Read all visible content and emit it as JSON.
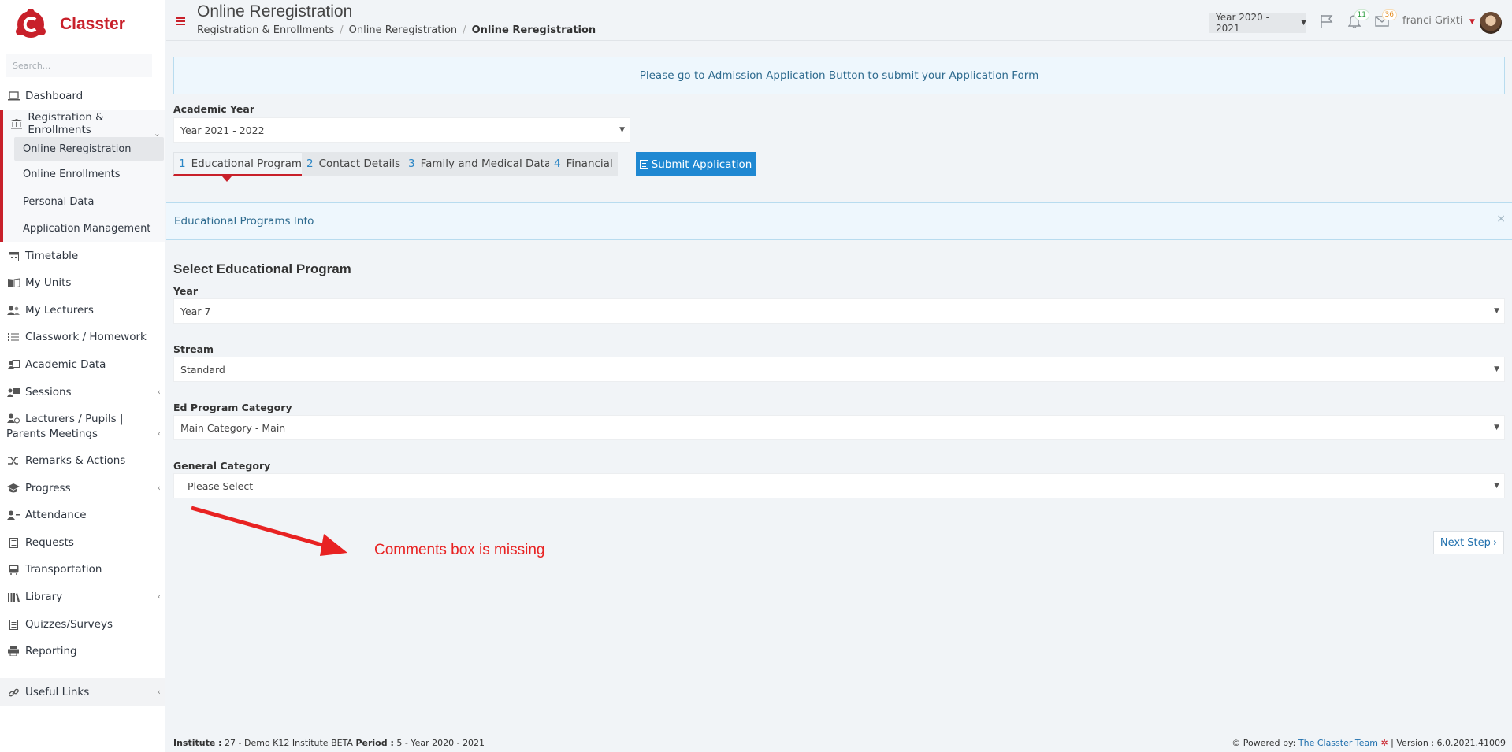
{
  "brand": {
    "name": "Classter",
    "accent": "#c8202a"
  },
  "search": {
    "placeholder": "Search..."
  },
  "sidebar": {
    "items": [
      {
        "label": "Dashboard",
        "icon": "laptop-icon"
      },
      {
        "label": "Registration & Enrollments",
        "icon": "bank-icon"
      },
      {
        "label": "Timetable",
        "icon": "calendar-icon"
      },
      {
        "label": "My Units",
        "icon": "book-icon"
      },
      {
        "label": "My Lecturers",
        "icon": "users-icon"
      },
      {
        "label": "Classwork / Homework",
        "icon": "tasks-icon"
      },
      {
        "label": "Academic Data",
        "icon": "id-card-icon"
      },
      {
        "label": "Sessions",
        "icon": "presentation-icon"
      },
      {
        "label": "Lecturers / Pupils | Parents Meetings",
        "icon": "meeting-icon"
      },
      {
        "label": "Remarks & Actions",
        "icon": "shuffle-icon"
      },
      {
        "label": "Progress",
        "icon": "graduation-cap-icon"
      },
      {
        "label": "Attendance",
        "icon": "user-check-icon"
      },
      {
        "label": "Requests",
        "icon": "document-icon"
      },
      {
        "label": "Transportation",
        "icon": "bus-icon"
      },
      {
        "label": "Library",
        "icon": "library-icon"
      },
      {
        "label": "Quizzes/Surveys",
        "icon": "list-icon"
      },
      {
        "label": "Reporting",
        "icon": "printer-icon"
      },
      {
        "label": "Useful Links",
        "icon": "link-icon"
      }
    ],
    "sub_items": [
      {
        "label": "Online Reregistration"
      },
      {
        "label": "Online Enrollments"
      },
      {
        "label": "Personal Data"
      },
      {
        "label": "Application Management"
      }
    ]
  },
  "header": {
    "title": "Online Reregistration",
    "breadcrumb": [
      "Registration & Enrollments",
      "Online Reregistration",
      "Online Reregistration"
    ],
    "year_select": "Year 2020 - 2021",
    "notifications_count": "11",
    "messages_count": "36",
    "user_name": "franci Grixti"
  },
  "main": {
    "banner": "Please go to Admission Application Button to submit your Application Form",
    "academic_year": {
      "label": "Academic Year",
      "value": "Year 2021 - 2022"
    },
    "tabs": [
      {
        "num": "1",
        "label": "Educational Program"
      },
      {
        "num": "2",
        "label": "Contact Details"
      },
      {
        "num": "3",
        "label": "Family and Medical Data"
      },
      {
        "num": "4",
        "label": "Financial"
      }
    ],
    "submit_label": "Submit Application",
    "panel_title": "Educational Programs Info",
    "panel_close": "×",
    "section_title": "Select Educational Program",
    "fields": [
      {
        "label": "Year",
        "value": "Year 7"
      },
      {
        "label": "Stream",
        "value": "Standard"
      },
      {
        "label": "Ed Program Category",
        "value": "Main Category - Main"
      },
      {
        "label": "General Category",
        "value": "--Please Select--"
      }
    ],
    "next_label": "Next Step",
    "annotation": "Comments box is missing"
  },
  "footer": {
    "institute_label": "Institute :",
    "institute_value": "27 - Demo K12 Institute BETA",
    "period_label": "Period :",
    "period_value": "5 - Year 2020 - 2021",
    "powered_by": "Powered by:",
    "team": "The Classter Team",
    "version": "| Version : 6.0.2021.41009"
  }
}
